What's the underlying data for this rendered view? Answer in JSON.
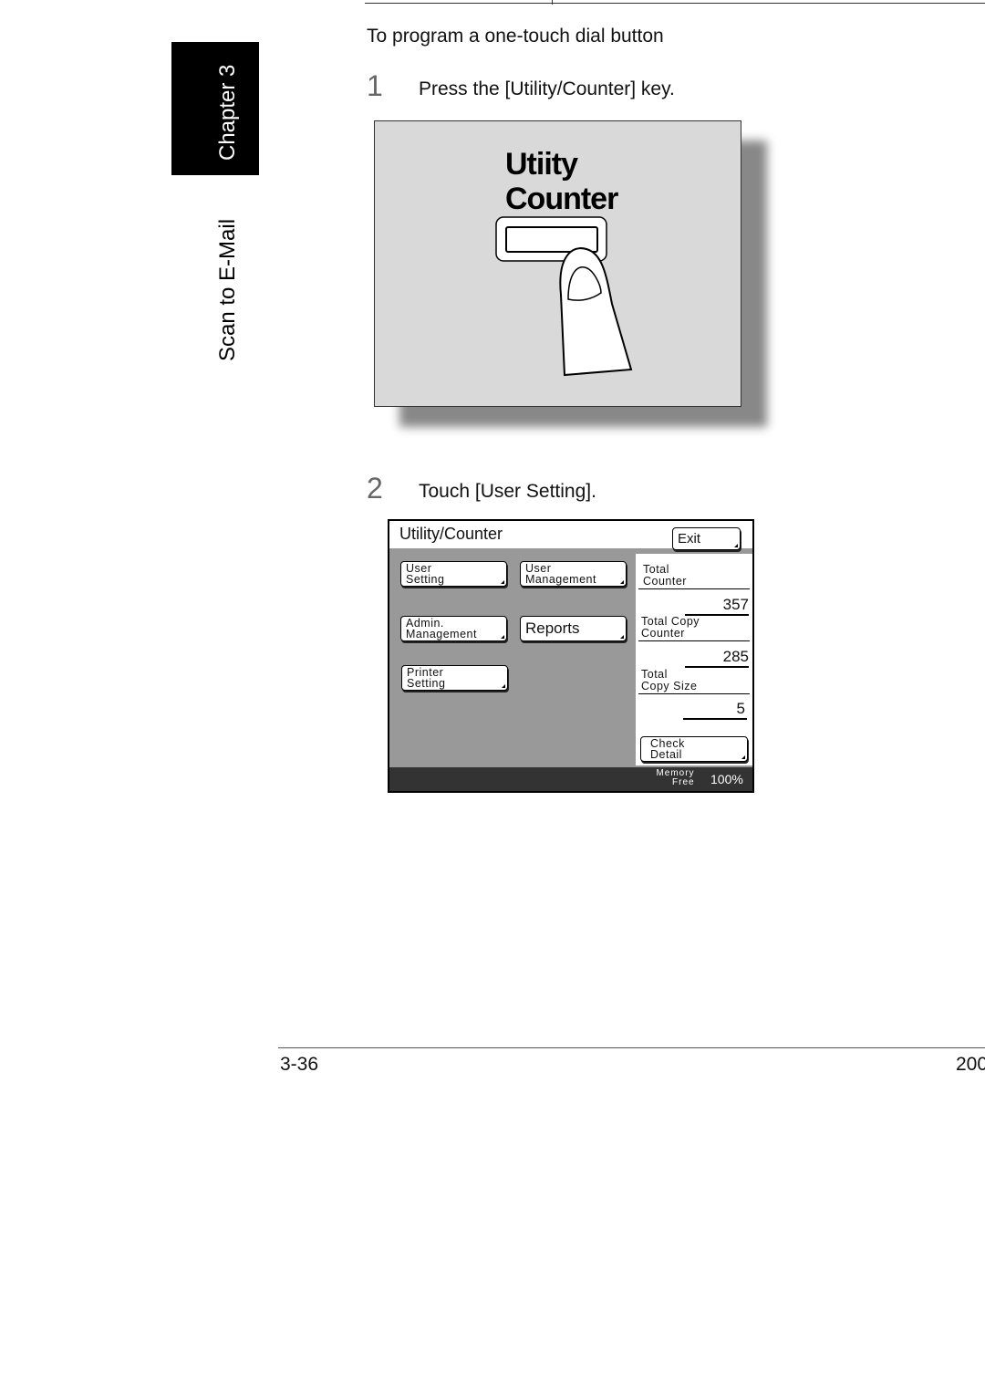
{
  "sidebar": {
    "chapter": "Chapter 3",
    "section": "Scan to E-Mail"
  },
  "heading": "To program a one-touch dial button",
  "steps": [
    {
      "number": "1",
      "text": "Press the [Utility/Counter] key."
    },
    {
      "number": "2",
      "text": "Touch [User Setting]."
    }
  ],
  "key_illustration": {
    "line1": "Utiity",
    "line2": "Counter"
  },
  "panel": {
    "title": "Utility/Counter",
    "exit": "Exit",
    "buttons": {
      "user_setting": [
        "User",
        "Setting"
      ],
      "user_management": [
        "User",
        "Management"
      ],
      "admin_management": [
        "Admin.",
        "Management"
      ],
      "reports": "Reports",
      "printer_setting": [
        "Printer",
        "Setting"
      ]
    },
    "counters": [
      {
        "label": [
          "Total",
          "Counter"
        ],
        "value": "357"
      },
      {
        "label": [
          "Total Copy",
          "Counter"
        ],
        "value": "285"
      },
      {
        "label": [
          "Total",
          "Copy Size"
        ],
        "value": "5"
      }
    ],
    "check_detail": [
      "Check",
      "Detail"
    ],
    "memory": {
      "label1": "Memory",
      "label2": "Free",
      "value": "100%"
    }
  },
  "footer": {
    "page": "3-36",
    "right": "200"
  }
}
